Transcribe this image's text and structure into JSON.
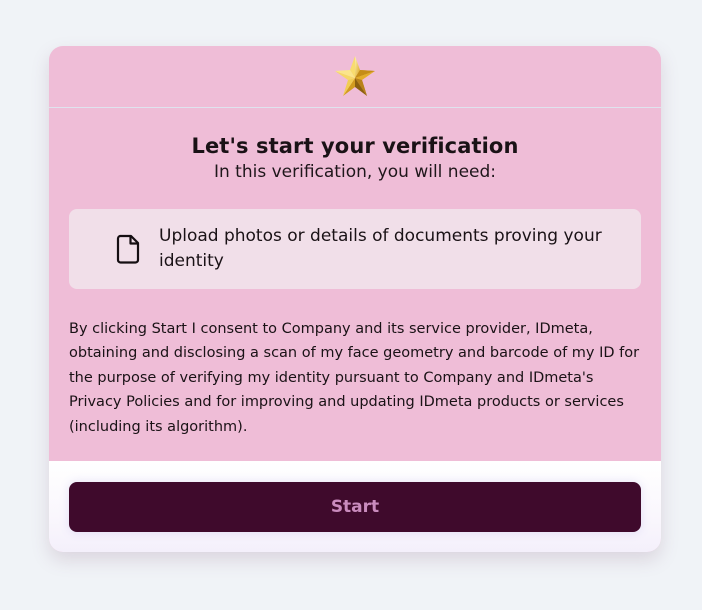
{
  "header": {
    "logo_icon": "gold-star-icon"
  },
  "intro": {
    "title": "Let's start your verification",
    "subtitle": "In this verification, you will need:"
  },
  "requirements": [
    {
      "icon": "document-icon",
      "label": "Upload photos or details of documents proving your identity"
    }
  ],
  "consent": {
    "text": "By clicking Start I consent to Company and its service provider, IDmeta, obtaining and disclosing a scan of my face geometry and barcode of my ID for the purpose of verifying my identity pursuant to Company and IDmeta's Privacy Policies and for improving and updating IDmeta products or services (including its algorithm)."
  },
  "actions": {
    "start_label": "Start"
  },
  "colors": {
    "page_background": "#f0f3f7",
    "card_background": "#efbdd7",
    "requirement_background": "#f1dfe9",
    "button_background": "#3f0a2c",
    "button_text": "#c98bbd",
    "star_gold": "#e6b830"
  }
}
